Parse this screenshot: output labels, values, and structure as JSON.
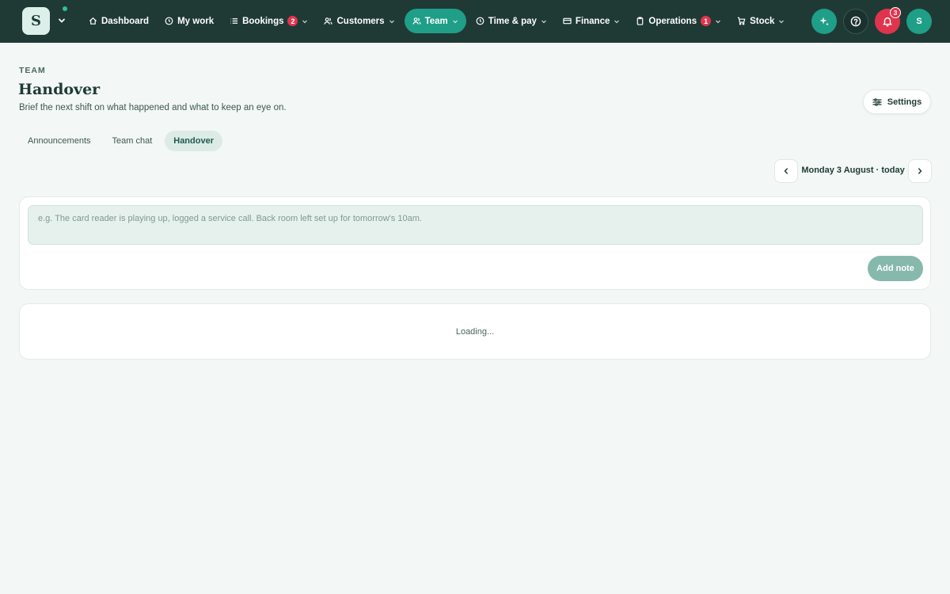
{
  "app": {
    "logo_letter": "S"
  },
  "nav": {
    "items": [
      {
        "label": "Dashboard",
        "icon": "home-icon"
      },
      {
        "label": "My work",
        "icon": "clock-icon"
      },
      {
        "label": "Bookings",
        "icon": "list-icon",
        "badge": "2"
      },
      {
        "label": "Customers",
        "icon": "users-icon"
      },
      {
        "label": "Team",
        "icon": "team-icon",
        "active": true
      },
      {
        "label": "Time & pay",
        "icon": "clock-icon"
      },
      {
        "label": "Finance",
        "icon": "card-icon"
      },
      {
        "label": "Operations",
        "icon": "clipboard-icon",
        "badge": "1"
      },
      {
        "label": "Stock",
        "icon": "cart-icon"
      }
    ]
  },
  "toolbar": {
    "notifications_count": "3",
    "avatar_initial": "S"
  },
  "page": {
    "eyebrow": "TEAM",
    "title": "Handover",
    "subtitle": "Brief the next shift on what happened and what to keep an eye on.",
    "settings_label": "Settings"
  },
  "tabs": [
    {
      "label": "Announcements"
    },
    {
      "label": "Team chat"
    },
    {
      "label": "Handover",
      "active": true
    }
  ],
  "date_nav": {
    "label": "Monday 3 August · today"
  },
  "composer": {
    "placeholder": "e.g. The card reader is playing up, logged a service call. Back room left set up for tomorrow's 10am.",
    "value": "",
    "add_label": "Add note"
  },
  "feed": {
    "status": "Loading..."
  },
  "colors": {
    "topbar": "#1f3a35",
    "accent": "#1f9e88",
    "alert": "#e0344e",
    "background": "#f3f7f6"
  }
}
